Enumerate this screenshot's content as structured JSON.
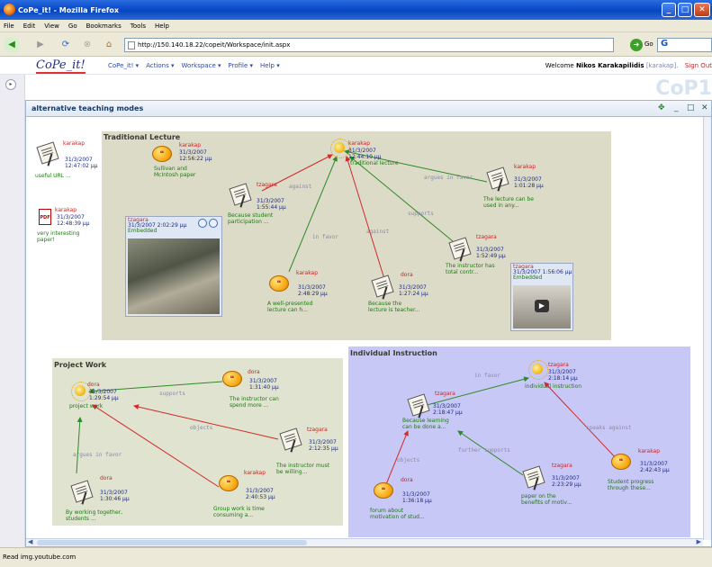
{
  "window": {
    "title": "CoPe_it! - Mozilla Firefox"
  },
  "menubar": [
    "File",
    "Edit",
    "View",
    "Go",
    "Bookmarks",
    "Tools",
    "Help"
  ],
  "nav": {
    "url": "http://150.140.18.22/copeit/Workspace/init.aspx",
    "go": "Go"
  },
  "app": {
    "logo": "CoPe_it!",
    "menu": [
      "CoPe_it! ▾",
      "Actions ▾",
      "Workspace ▾",
      "Profile ▾",
      "Help ▾"
    ],
    "welcome": "Welcome",
    "user": "Nikos Karakapilidis",
    "user_login": "[karakap].",
    "signout": "Sign Out",
    "brand": "CoP1"
  },
  "workspace": {
    "title": "alternative teaching modes"
  },
  "regions": {
    "lecture": "Traditional Lecture",
    "project": "Project Work",
    "individual": "Individual Instruction"
  },
  "colors": {
    "lecture_bg": "#dcdbc8",
    "project_bg": "#dfe3d0",
    "individual_bg": "#c8c8f6",
    "arrow_green": "#2e8a26",
    "arrow_red": "#d22a2a"
  },
  "nodes": [
    {
      "id": "n1",
      "icon": "document-icon",
      "user": "karakap",
      "date": "31/3/2007",
      "time": "12:47:02 μμ",
      "cap": "useful URL ..."
    },
    {
      "id": "n2",
      "icon": "pdf-icon",
      "user": "karakap",
      "date": "31/3/2007",
      "time": "12:48:39 μμ",
      "cap": "very interesting paper!"
    },
    {
      "id": "n3",
      "icon": "comment-bubble-icon",
      "user": "karakap",
      "date": "31/3/2007",
      "time": "12:56:22 μμ",
      "cap": "Sullivan and McIntosh paper"
    },
    {
      "id": "n4",
      "icon": "idea-bulb-icon",
      "user": "karakap",
      "date": "31/3/2007",
      "time": "12:44:10 μμ",
      "cap": "traditional lecture"
    },
    {
      "id": "n5",
      "icon": "document-icon",
      "user": "tzagara",
      "date": "31/3/2007",
      "time": "1:55:44 μμ",
      "cap": "Because student participation ..."
    },
    {
      "id": "n6",
      "icon": "document-icon",
      "user": "karakap",
      "date": "31/3/2007",
      "time": "1:01:28 μμ",
      "cap": "The lecture can be used in any..."
    },
    {
      "id": "n7",
      "icon": "document-icon",
      "user": "tzagara",
      "date": "31/3/2007",
      "time": "1:52:49 μμ",
      "cap": "The instructor has total contr..."
    },
    {
      "id": "n8",
      "icon": "comment-bubble-icon",
      "user": "karakap",
      "date": "31/3/2007",
      "time": "2:48:29 μμ",
      "cap": "A well-presented lecture can h..."
    },
    {
      "id": "n9",
      "icon": "document-icon",
      "user": "dora",
      "date": "31/3/2007",
      "time": "1:27:24 μμ",
      "cap": "Because the lecture is teacher..."
    },
    {
      "id": "p1",
      "icon": "idea-bulb-icon",
      "user": "dora",
      "date": "31/3/2007",
      "time": "1:29:54 μμ",
      "cap": "project work"
    },
    {
      "id": "p2",
      "icon": "comment-bubble-icon",
      "user": "dora",
      "date": "31/3/2007",
      "time": "1:31:40 μμ",
      "cap": "The instructor can spend more ..."
    },
    {
      "id": "p3",
      "icon": "document-icon",
      "user": "tzagara",
      "date": "31/3/2007",
      "time": "2:12:35 μμ",
      "cap": "The instructor must be willing..."
    },
    {
      "id": "p4",
      "icon": "document-icon",
      "user": "dora",
      "date": "31/3/2007",
      "time": "1:30:46 μμ",
      "cap": "By working together, students ..."
    },
    {
      "id": "p5",
      "icon": "comment-bubble-icon",
      "user": "karakap",
      "date": "31/3/2007",
      "time": "2:40:53 μμ",
      "cap": "Group work is time consuming a..."
    },
    {
      "id": "i1",
      "icon": "idea-bulb-icon",
      "user": "tzagara",
      "date": "31/3/2007",
      "time": "2:18:14 μμ",
      "cap": "individual instruction"
    },
    {
      "id": "i2",
      "icon": "document-icon",
      "user": "tzagara",
      "date": "31/3/2007",
      "time": "2:18:47 μμ",
      "cap": "Because learning can be done a..."
    },
    {
      "id": "i3",
      "icon": "comment-bubble-icon",
      "user": "karakap",
      "date": "31/3/2007",
      "time": "2:42:43 μμ",
      "cap": "Student progress through these..."
    },
    {
      "id": "i4",
      "icon": "document-icon",
      "user": "tzagara",
      "date": "31/3/2007",
      "time": "2:23:29 μμ",
      "cap": "paper on the benefits of motiv..."
    },
    {
      "id": "i5",
      "icon": "comment-bubble-icon",
      "user": "dora",
      "date": "31/3/2007",
      "time": "1:36:18 μμ",
      "cap": "forum about motivation of stud..."
    }
  ],
  "links": {
    "against": "against",
    "argues_in_favor": "argues in favor",
    "in_favor": "in favor",
    "supports": "supports",
    "objects": "objects",
    "further_supports": "further supports",
    "speaks_against": "speaks against"
  },
  "embeds": [
    {
      "user": "tzagara",
      "datetime": "31/3/2007 2:02:29 μμ",
      "label": "Embedded"
    },
    {
      "user": "tzagara",
      "datetime": "31/3/2007 1:56:06 μμ",
      "label": "Embedded"
    }
  ],
  "status": "Read img.youtube.com"
}
